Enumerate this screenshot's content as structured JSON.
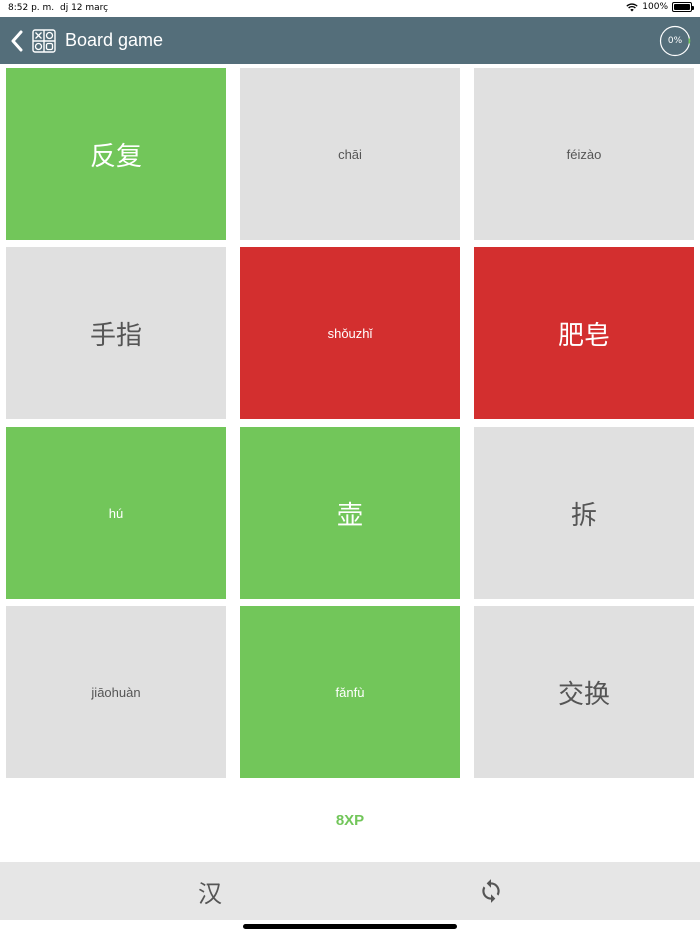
{
  "status_bar": {
    "time": "8:52 p. m.",
    "date": "dj 12 març",
    "battery": "100%"
  },
  "header": {
    "title": "Board game",
    "progress": "0%",
    "progress_value": 0
  },
  "board": {
    "tiles": [
      {
        "text": "反复",
        "kind": "hanzi",
        "state": "green"
      },
      {
        "text": "chāi",
        "kind": "pinyin",
        "state": "gray"
      },
      {
        "text": "féizào",
        "kind": "pinyin",
        "state": "gray"
      },
      {
        "text": "手指",
        "kind": "hanzi",
        "state": "gray"
      },
      {
        "text": "shǒuzhǐ",
        "kind": "pinyin",
        "state": "red"
      },
      {
        "text": "肥皂",
        "kind": "hanzi",
        "state": "red"
      },
      {
        "text": "hú",
        "kind": "pinyin",
        "state": "green"
      },
      {
        "text": "壶",
        "kind": "hanzi",
        "state": "green"
      },
      {
        "text": "拆",
        "kind": "hanzi",
        "state": "gray"
      },
      {
        "text": "jiāohuàn",
        "kind": "pinyin",
        "state": "gray"
      },
      {
        "text": "fǎnfù",
        "kind": "pinyin",
        "state": "green"
      },
      {
        "text": "交换",
        "kind": "hanzi",
        "state": "gray"
      }
    ]
  },
  "xp": "8XP",
  "bottom_bar": {
    "hanzi_toggle": "汉",
    "refresh_icon": "refresh-icon"
  },
  "colors": {
    "header": "#546e7a",
    "green": "#72c65a",
    "red": "#d32f2f",
    "gray": "#e0e0e0"
  }
}
